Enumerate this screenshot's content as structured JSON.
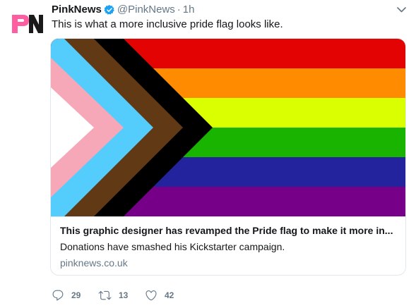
{
  "tweet": {
    "author_name": "PinkNews",
    "handle": "@PinkNews",
    "separator": "·",
    "time": "1h",
    "text": "This is what a more inclusive pride flag looks like."
  },
  "avatar": {
    "logo_text": "PN",
    "logo_color": "#ff5da2"
  },
  "card": {
    "title": "This graphic designer has revamped the Pride flag to make it more in...",
    "description": "Donations have smashed his Kickstarter campaign.",
    "domain": "pinknews.co.uk"
  },
  "actions": {
    "replies": "29",
    "retweets": "13",
    "likes": "42"
  },
  "icons": {
    "verified": "verified-badge-icon",
    "caret": "chevron-down-icon",
    "reply": "reply-icon",
    "retweet": "retweet-icon",
    "like": "heart-icon"
  },
  "colors": {
    "accent": "#1da1f2",
    "muted": "#657786",
    "flag_red": "#e40303",
    "flag_orange": "#ff8c00",
    "flag_yellow": "#d9ff00",
    "flag_green": "#19b400",
    "flag_blue": "#24239e",
    "flag_purple": "#770088",
    "flag_black": "#000000",
    "flag_brown": "#613915",
    "flag_light_blue": "#55cdfc",
    "flag_pink": "#f7a8b8",
    "flag_white": "#ffffff"
  }
}
